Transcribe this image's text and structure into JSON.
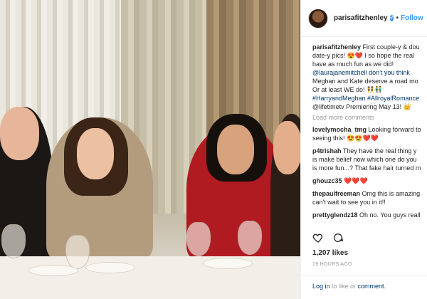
{
  "header": {
    "username": "parisafitzhenley",
    "verified_mark": "✔",
    "separator": "•",
    "follow_label": "Follow"
  },
  "caption": {
    "username": "parisafitzhenley",
    "lines": [
      "First couple-y & dou",
      "date-y pics! 😍❤️ I so hope the real",
      "have as much fun as we did!",
      "@laurajanemitchell don't you think",
      "Meghan and Kate deserve a road mo",
      "Or at least WE do! 👯👬",
      "#HarryandMeghan #AllroyalRomance",
      "@lifetimetv Premiering May 13! 👑"
    ]
  },
  "load_more": "Load more comments",
  "comments": [
    {
      "user": "lovelymocha_tmg",
      "text": "Looking forward to",
      "cont": "seeing this! 😍😍❤️❤️"
    },
    {
      "user": "p4trishah",
      "text": "They have the real thing y",
      "cont": "is make belief now which one do you",
      "cont2": "is more fun...? That fake hair turned m"
    },
    {
      "user": "ghouzc35",
      "text": "❤️❤️❤️"
    },
    {
      "user": "thepaulfreeman",
      "text": "Omg this is amazing",
      "cont": "can't wait to see you in it!!"
    },
    {
      "user": "prettyglendz18",
      "text": "Oh no. You guys reall"
    }
  ],
  "likes": "1,207 likes",
  "time_ago": "19 HOURS AGO",
  "login": {
    "link1": "Log in",
    "middle": " to like or ",
    "link2": "comment."
  },
  "icons": {
    "avatar": "avatar",
    "verified": "verified-badge-icon",
    "heart": "heart-icon",
    "comment": "comment-bubble-icon"
  },
  "colors": {
    "accent": "#3897f0",
    "link": "#003569",
    "muted": "#999999"
  }
}
